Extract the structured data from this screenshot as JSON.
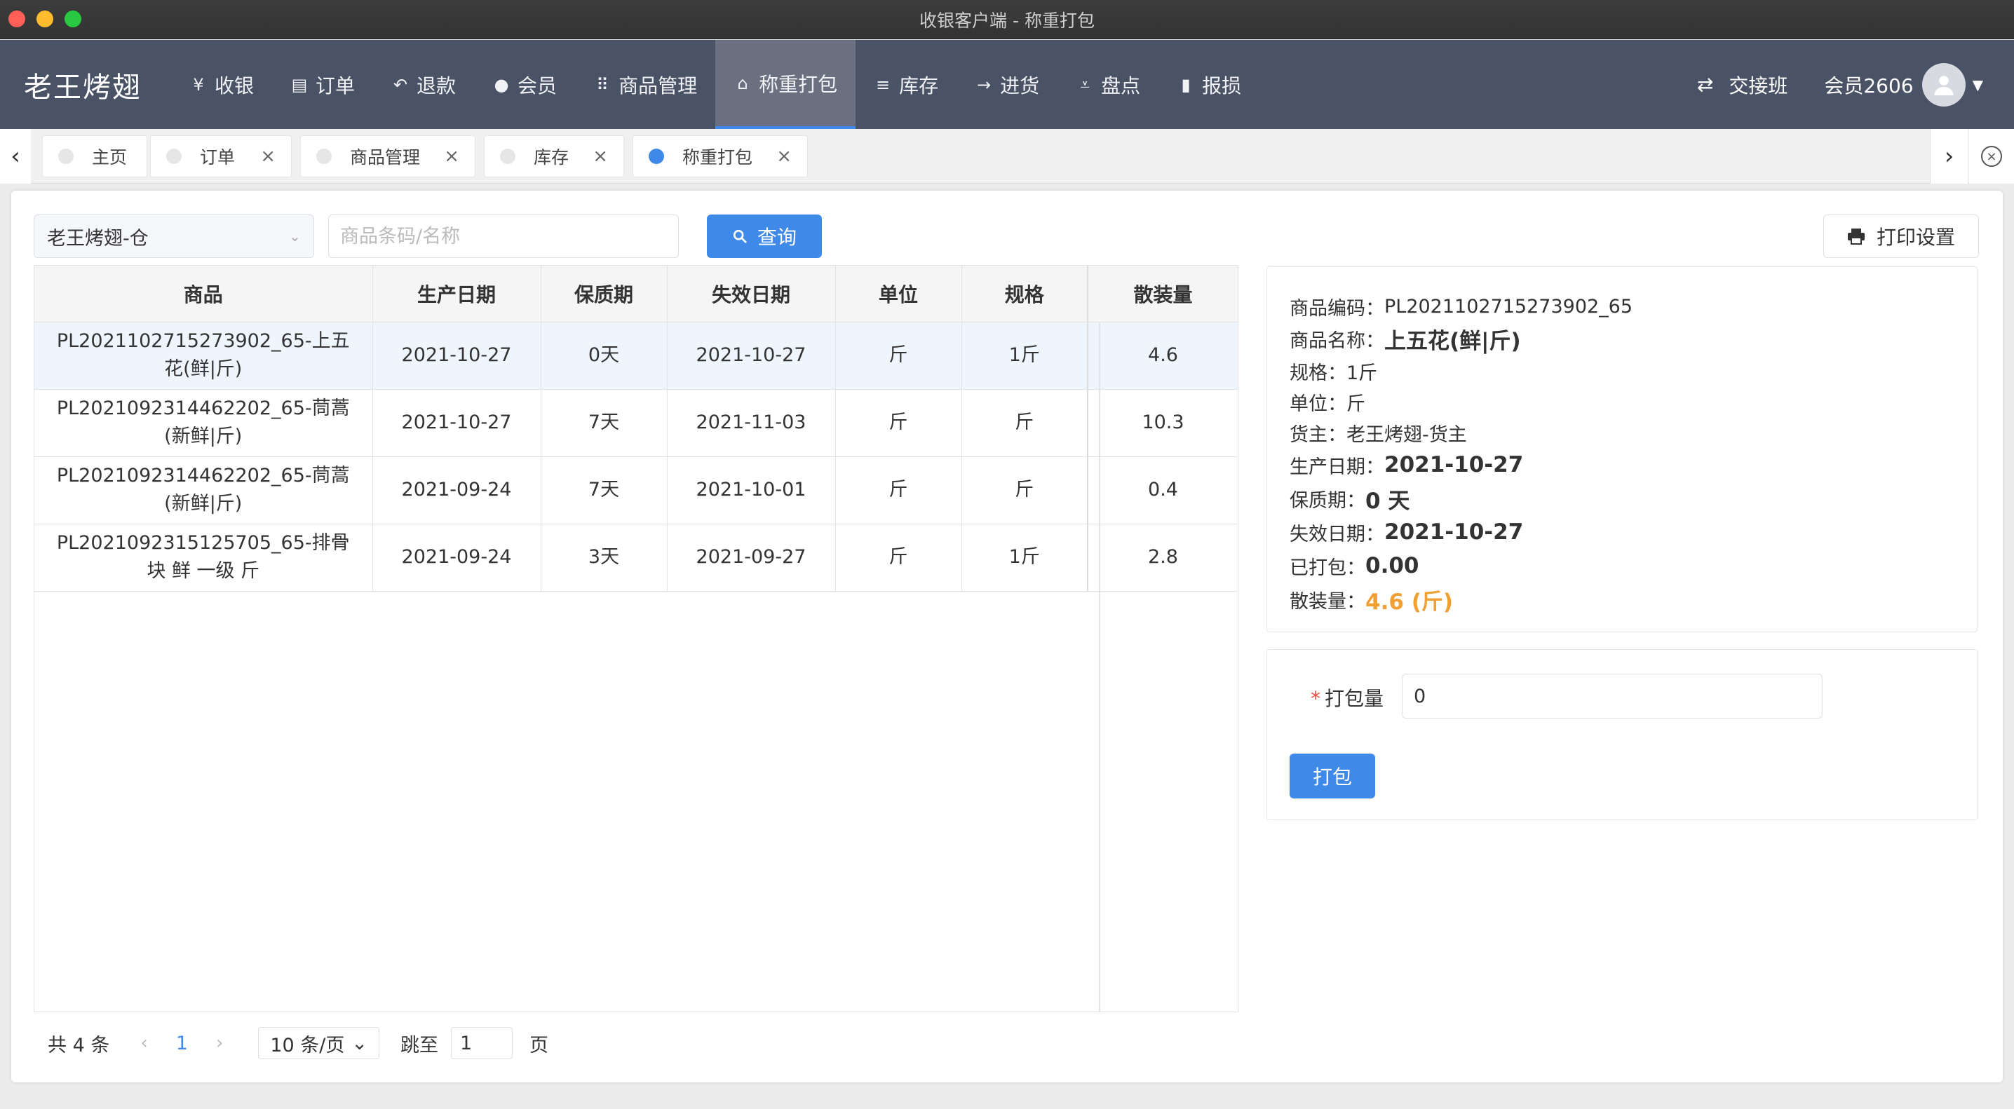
{
  "window": {
    "title": "收银客户端 - 称重打包"
  },
  "brand": "老王烤翅",
  "nav": [
    {
      "icon": "¥",
      "label": "收银"
    },
    {
      "icon": "▤",
      "label": "订单"
    },
    {
      "icon": "↶",
      "label": "退款"
    },
    {
      "icon": "●",
      "label": "会员"
    },
    {
      "icon": "⠿",
      "label": "商品管理"
    },
    {
      "icon": "⌂",
      "label": "称重打包"
    },
    {
      "icon": "≡",
      "label": "库存"
    },
    {
      "icon": "→",
      "label": "进货"
    },
    {
      "icon": "⩡",
      "label": "盘点"
    },
    {
      "icon": "▮",
      "label": "报损"
    }
  ],
  "header": {
    "shift_label": "交接班",
    "member_label": "会员2606"
  },
  "tabs": [
    {
      "label": "主页"
    },
    {
      "label": "订单"
    },
    {
      "label": "商品管理"
    },
    {
      "label": "库存"
    },
    {
      "label": "称重打包"
    }
  ],
  "filters": {
    "warehouse": "老王烤翅-仓",
    "search_placeholder": "商品条码/名称",
    "query_label": "查询",
    "print_settings_label": "打印设置"
  },
  "table": {
    "columns": [
      "商品",
      "生产日期",
      "保质期",
      "失效日期",
      "单位",
      "规格",
      "散装量"
    ],
    "rows": [
      {
        "product_line1": "PL2021102715273902_65-上五",
        "product_line2": "花(鲜|斤)",
        "production_date": "2021-10-27",
        "shelf_life": "0天",
        "expiry_date": "2021-10-27",
        "unit": "斤",
        "spec": "1斤",
        "bulk": "4.6"
      },
      {
        "product_line1": "PL2021092314462202_65-茼蒿",
        "product_line2": "(新鲜|斤)",
        "production_date": "2021-10-27",
        "shelf_life": "7天",
        "expiry_date": "2021-11-03",
        "unit": "斤",
        "spec": "斤",
        "bulk": "10.3"
      },
      {
        "product_line1": "PL2021092314462202_65-茼蒿",
        "product_line2": "(新鲜|斤)",
        "production_date": "2021-09-24",
        "shelf_life": "7天",
        "expiry_date": "2021-10-01",
        "unit": "斤",
        "spec": "斤",
        "bulk": "0.4"
      },
      {
        "product_line1": "PL2021092315125705_65-排骨",
        "product_line2": "块 鲜 一级 斤",
        "production_date": "2021-09-24",
        "shelf_life": "3天",
        "expiry_date": "2021-09-27",
        "unit": "斤",
        "spec": "1斤",
        "bulk": "2.8"
      }
    ]
  },
  "pagination": {
    "total_label": "共 4 条",
    "current_page": "1",
    "page_size_label": "10 条/页",
    "jump_label": "跳至",
    "jump_value": "1",
    "page_unit": "页"
  },
  "detail": {
    "code_label": "商品编码：",
    "code": "PL2021102715273902_65",
    "name_label": "商品名称：",
    "name": "上五花(鲜|斤)",
    "spec_label": "规格：",
    "spec": "1斤",
    "unit_label": "单位：",
    "unit": "斤",
    "owner_label": "货主：",
    "owner": "老王烤翅-货主",
    "production_label": "生产日期：",
    "production_date": "2021-10-27",
    "shelf_label": "保质期：",
    "shelf_life": "0 天",
    "expiry_label": "失效日期：",
    "expiry_date": "2021-10-27",
    "packed_label": "已打包：",
    "packed": "0.00",
    "bulk_label": "散装量：",
    "bulk": "4.6 (斤)"
  },
  "pack": {
    "required_mark": "*",
    "qty_label": "打包量",
    "qty_value": "0",
    "pack_button": "打包"
  },
  "colors": {
    "accent": "#3f8ae8",
    "nav_bg": "#4a5266",
    "highlight": "#f0a032"
  }
}
